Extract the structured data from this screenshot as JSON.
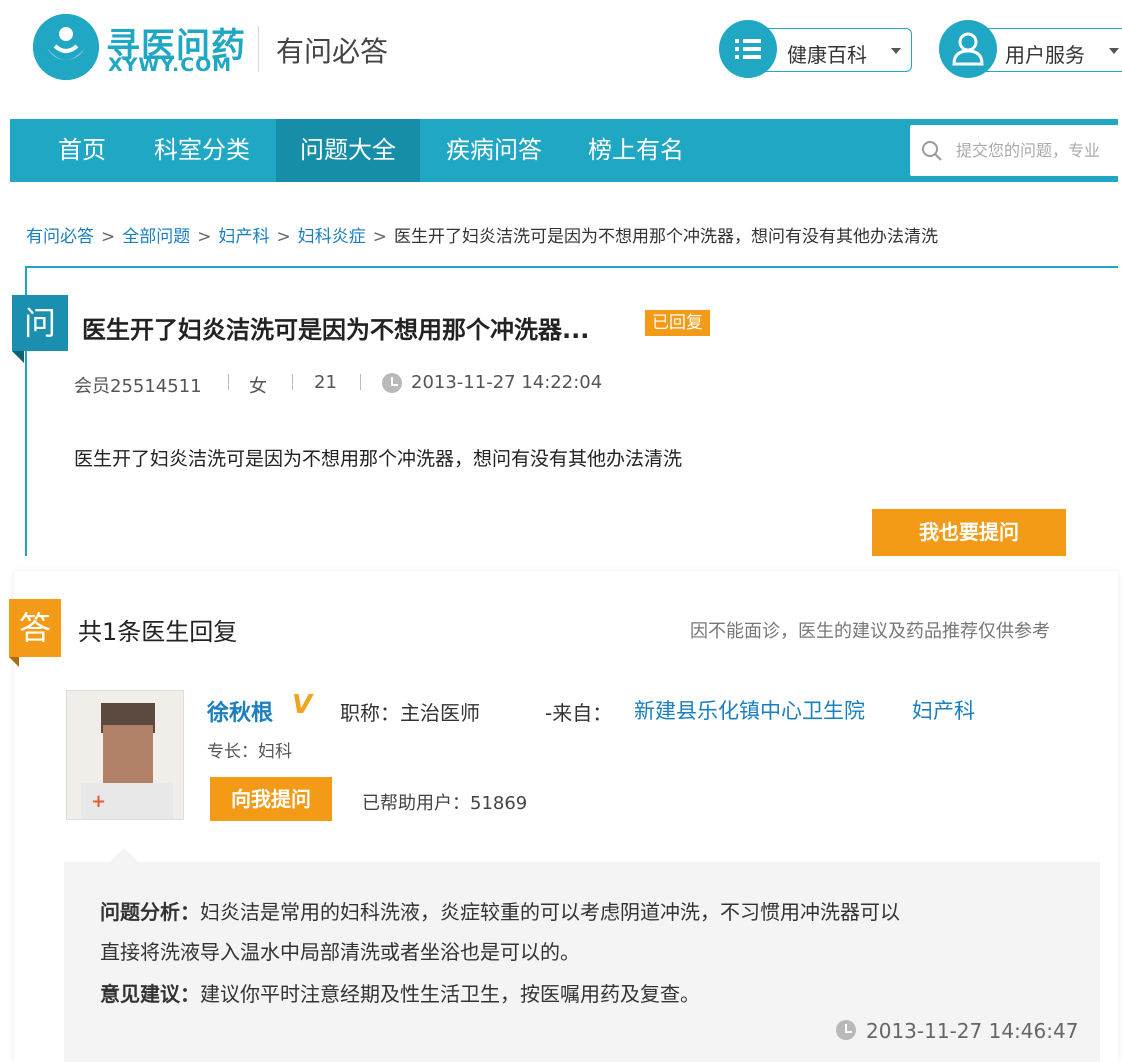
{
  "header": {
    "brand_cn": "寻医问药",
    "brand_en": "XYWY.COM",
    "section_title": "有问必答",
    "health_menu_label": "健康百科",
    "user_menu_label": "用户服务"
  },
  "nav": {
    "items": [
      {
        "label": "首页"
      },
      {
        "label": "科室分类"
      },
      {
        "label": "问题大全",
        "active": true
      },
      {
        "label": "疾病问答"
      },
      {
        "label": "榜上有名"
      }
    ],
    "search_placeholder": "提交您的问题，专业",
    "accent_color": "#1fa7c4"
  },
  "breadcrumb": {
    "items": [
      "有问必答",
      "全部问题",
      "妇产科",
      "妇科炎症"
    ],
    "current": "医生开了妇炎洁洗可是因为不想用那个冲洗器，想问有没有其他办法清洗",
    "separator": ">"
  },
  "question": {
    "badge": "问",
    "title": "医生开了妇炎洁洗可是因为不想用那个冲洗器...",
    "status": "已回复",
    "member": "会员25514511",
    "gender": "女",
    "age": "21",
    "time": "2013-11-27 14:22:04",
    "body": "医生开了妇炎洁洗可是因为不想用那个冲洗器，想问有没有其他办法清洗",
    "ask_button": "我也要提问"
  },
  "answers": {
    "badge": "答",
    "count_text": "共1条医生回复",
    "disclaimer": "因不能面诊，医生的建议及药品推荐仅供参考",
    "doctor": {
      "name": "徐秋根",
      "verified_mark": "V",
      "title_text": "职称：主治医师",
      "from_label": "-来自：",
      "hospital": "新建县乐化镇中心卫生院",
      "department": "妇产科",
      "specialty": "专长：妇科",
      "ask_me_button": "向我提问",
      "helped_text": "已帮助用户：51869"
    },
    "reply": {
      "analysis_label": "问题分析：",
      "analysis_line1": "妇炎洁是常用的妇科洗液，炎症较重的可以考虑阴道冲洗，不习惯用冲洗器可以",
      "analysis_line2": "直接将洗液导入温水中局部清洗或者坐浴也是可以的。",
      "advice_label": "意见建议：",
      "advice_text": "建议你平时注意经期及性生活卫生，按医嘱用药及复查。",
      "time": "2013-11-27 14:46:47"
    }
  }
}
